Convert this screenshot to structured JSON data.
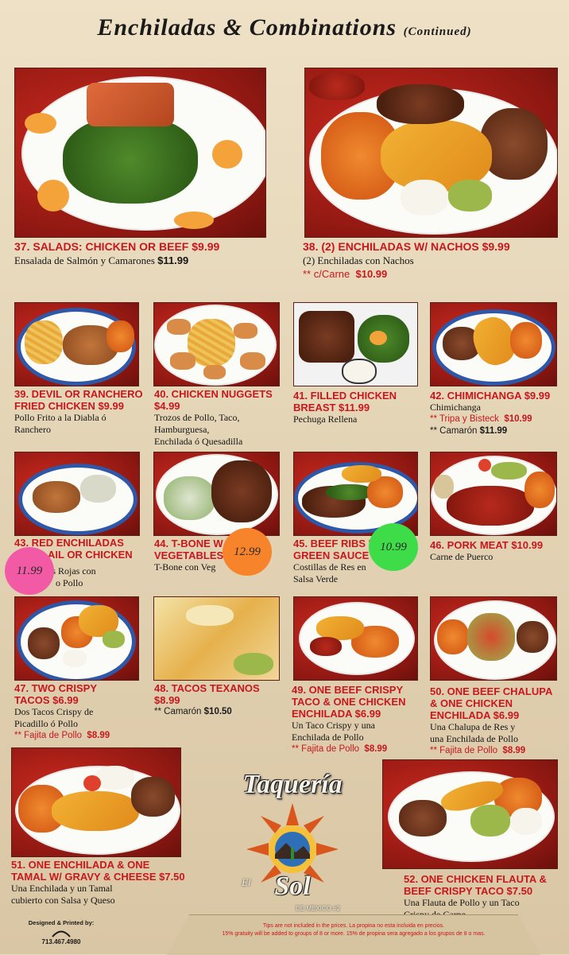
{
  "header": {
    "title": "Enchiladas & Combinations",
    "subtitle": "(Continued)"
  },
  "items": [
    {
      "id": "37",
      "name": "37. SALADS: CHICKEN OR BEEF $9.99",
      "desc": "Ensalada de Salmón y Camarones",
      "desc_price": "$11.99"
    },
    {
      "id": "38",
      "name": "38. (2) ENCHILADAS w/ NACHOS $9.99",
      "desc": "(2) Enchiladas con Nachos",
      "extra": "** c/Carne",
      "extra_price": "$10.99"
    },
    {
      "id": "39",
      "name_1": "39. DEVIL OR RANCHERO",
      "name_2": "FRIED CHICKEN $9.99",
      "desc_1": "Pollo Frito a la Diabla ó",
      "desc_2": "Ranchero"
    },
    {
      "id": "40",
      "name_1": "40. CHICKEN NUGGETS",
      "name_2": "$4.99",
      "desc_1": "Trozos de Pollo, Taco,",
      "desc_2": "Hamburguesa,",
      "desc_3": "Enchilada ó Quesadilla"
    },
    {
      "id": "41",
      "name_1": "41. FILLED CHICKEN",
      "name_2": "BREAST $11.99",
      "desc_1": "Pechuga Rellena"
    },
    {
      "id": "42",
      "name_1": "42. CHIMICHANGA $9.99",
      "desc_1": "Chimichanga",
      "extra_1": "** Tripa y Bisteck",
      "extra_1_price": "$10.99",
      "extra_2": "** Camarón",
      "extra_2_price": "$11.99"
    },
    {
      "id": "43",
      "name_1": "43. RED ENCHILADAS",
      "name_2": "AIL OR CHICKEN",
      "desc_1": "as Rojas con",
      "desc_2": "o Pollo"
    },
    {
      "id": "44",
      "name_1": "44. T-BONE w",
      "name_2": "VEGETABLES",
      "desc_1": "T-Bone con Veg"
    },
    {
      "id": "45",
      "name_1": "45. BEEF RIBS IN",
      "name_2": "GREEN SAUCE $",
      "desc_1": "Costillas de Res en",
      "desc_2": "Salsa Verde"
    },
    {
      "id": "46",
      "name_1": "46. PORK MEAT $10.99",
      "desc_1": "Carne de Puerco"
    },
    {
      "id": "47",
      "name_1": "47. TWO CRISPY",
      "name_2": "TACOS $6.99",
      "desc_1": "Dos Tacos Crispy de",
      "desc_2": "Picadillo ó Pollo",
      "extra_1": "** Fajita de Pollo",
      "extra_1_price": "$8.99"
    },
    {
      "id": "48",
      "name_1": "48. TACOS TEXANOS",
      "name_2": "$8.99",
      "extra_1": "** Camarón",
      "extra_1_price": "$10.50"
    },
    {
      "id": "49",
      "name_1": "49. ONE BEEF CRISPY",
      "name_2": "TACO & ONE CHICKEN",
      "name_3": "ENCHILADA $6.99",
      "desc_1": "Un Taco Crispy y una",
      "desc_2": "Enchilada de Pollo",
      "extra_1": "** Fajita de Pollo",
      "extra_1_price": "$8.99"
    },
    {
      "id": "50",
      "name_1": "50. ONE BEEF CHALUPA",
      "name_2": "& ONE CHICKEN",
      "name_3": "ENCHILADA $6.99",
      "desc_1": "Una Chalupa de Res y",
      "desc_2": "una Enchilada de Pollo",
      "extra_1": "** Fajita de Pollo",
      "extra_1_price": "$8.99"
    },
    {
      "id": "51",
      "name_1": "51. ONE ENCHILADA & ONE",
      "name_2": "TAMAL w/ GRAVY & CHEESE $7.50",
      "desc_1": "Una Enchilada y un Tamal",
      "desc_2": "cubierto con Salsa y Queso"
    },
    {
      "id": "52",
      "name_1": "52. ONE CHICKEN FLAUTA &",
      "name_2": "BEEF CRISPY TACO $7.50",
      "desc_1": "Una Flauta de Pollo y un Taco",
      "desc_2": "Crispy de Carne"
    }
  ],
  "stickers": {
    "s43": "11.99",
    "s44": "12.99",
    "s45": "10.99"
  },
  "logo": {
    "title": "Taquería",
    "el": "El",
    "sol": "Sol",
    "sub": "DE MEXICO #2"
  },
  "footer": {
    "credit": "Designed & Printed by:",
    "phone": "713.467.4980",
    "notice_1": "Tips are not included in the prices. La propina no esta incluida en precios.",
    "notice_2": "15% gratuity will be added to groups of 8 or more. 15% de propina sera agregado a los grupos de 8 o mas."
  },
  "colors": {
    "item_name": "#c8171d",
    "background": "#e7d9bd",
    "sticker_pink": "#f25aa6",
    "sticker_orange": "#f7832a",
    "sticker_green": "#3ddc48"
  }
}
